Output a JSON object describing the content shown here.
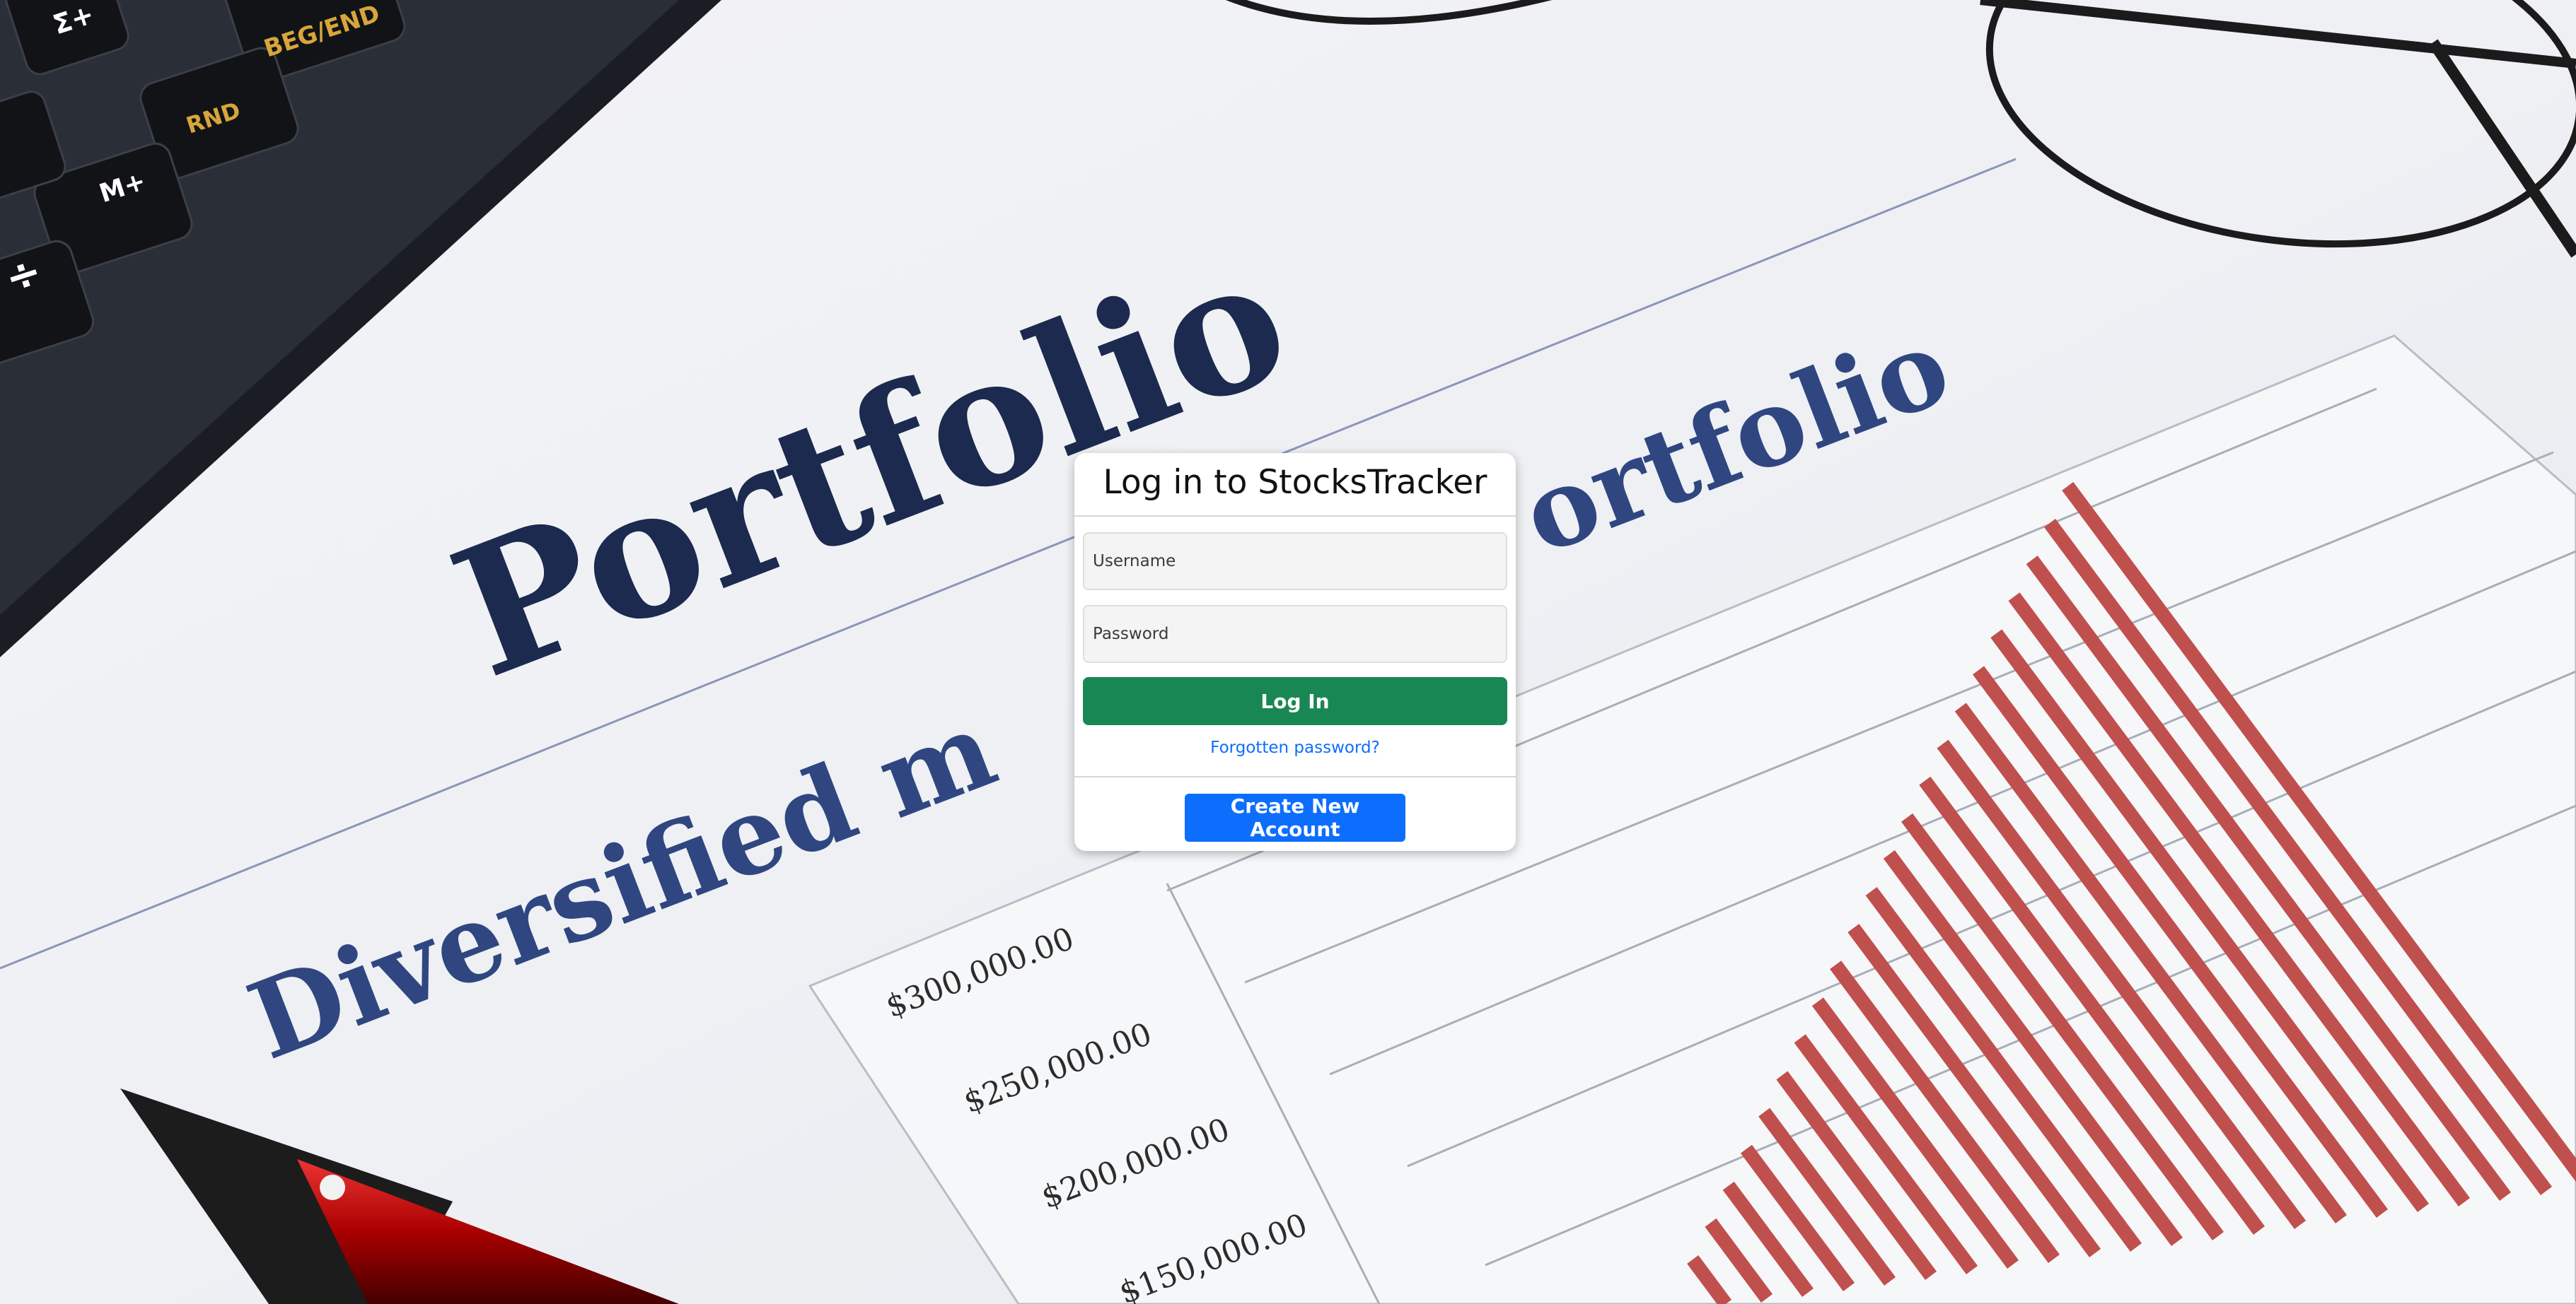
{
  "login_card": {
    "title": "Log in to StocksTracker",
    "username_placeholder": "Username",
    "password_placeholder": "Password",
    "login_label": "Log In",
    "forgot_label": "Forgotten password?",
    "create_label": "Create New Account"
  },
  "background_photo": {
    "heading": "Portfolio",
    "subheading_left": "Diversified m",
    "subheading_right": "ortfolio",
    "axis_labels": [
      "$300,000.00",
      "$250,000.00",
      "$200,000.00",
      "$150,000.00"
    ],
    "calculator_keys": [
      "Σ+",
      "BEG/END",
      "RND",
      "M+",
      "÷"
    ]
  },
  "colors": {
    "login_button": "#198754",
    "create_button": "#0d6efd",
    "link": "#0d6efd",
    "heading_navy": "#1b2a4e",
    "bar_red": "#c0504d"
  }
}
